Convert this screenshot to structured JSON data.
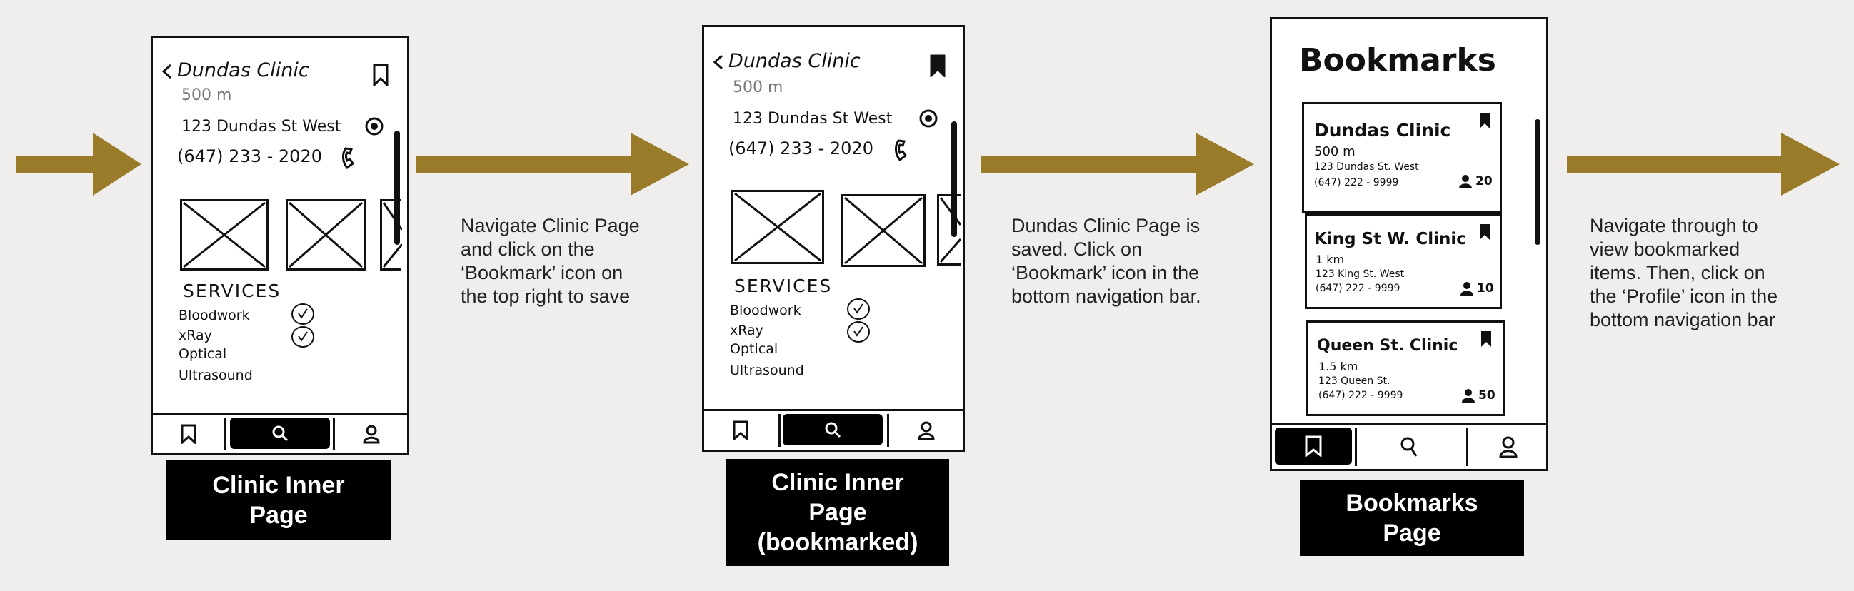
{
  "steps": [
    {
      "caption": [
        "Clinic Inner",
        "Page"
      ],
      "description": [
        "Navigate Clinic Page",
        "and click on the",
        "‘Bookmark’ icon on",
        "the top right to save"
      ],
      "screen": {
        "title": "Dundas Clinic",
        "distance": "500 m",
        "address": "123 Dundas St West",
        "phone": "(647) 233 - 2020",
        "services_heading": "SERVICES",
        "services": [
          "Bloodwork",
          "xRay",
          "Optical",
          "Ultrasound"
        ],
        "bookmarked": false
      }
    },
    {
      "caption": [
        "Clinic Inner",
        "Page",
        "(bookmarked)"
      ],
      "description": [
        "Dundas Clinic Page is",
        "saved. Click on",
        "‘Bookmark’ icon in the",
        "bottom navigation bar."
      ],
      "screen": {
        "title": "Dundas Clinic",
        "distance": "500 m",
        "address": "123 Dundas St West",
        "phone": "(647) 233 - 2020",
        "services_heading": "SERVICES",
        "services": [
          "Bloodwork",
          "xRay",
          "Optical",
          "Ultrasound"
        ],
        "bookmarked": true
      }
    },
    {
      "caption": [
        "Bookmarks",
        "Page"
      ],
      "description": [
        "Navigate through to",
        "view bookmarked",
        "items. Then, click on",
        "the ‘Profile’ icon in the",
        "bottom navigation bar"
      ],
      "screen": {
        "title": "Bookmarks",
        "cards": [
          {
            "name": "Dundas Clinic",
            "distance": "500 m",
            "address": "123 Dundas St. West",
            "phone": "(647) 222 - 9999",
            "count": "20"
          },
          {
            "name": "King St W. Clinic",
            "distance": "1 km",
            "address": "123 King St. West",
            "phone": "(647) 222 - 9999",
            "count": "10"
          },
          {
            "name": "Queen St. Clinic",
            "distance": "1.5 km",
            "address": "123 Queen St.",
            "phone": "(647) 222 - 9999",
            "count": "50"
          }
        ]
      }
    }
  ],
  "colors": {
    "arrow": "#9a7b2a",
    "background": "#efeeed",
    "caption_bg": "#000000"
  },
  "icons": [
    "bookmark-icon",
    "search-icon",
    "profile-icon",
    "location-icon",
    "phone-icon",
    "back-chevron-icon",
    "person-icon"
  ]
}
